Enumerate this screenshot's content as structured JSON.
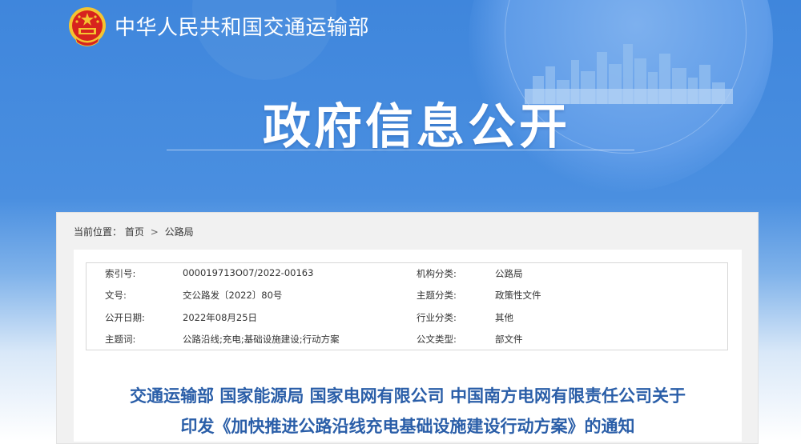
{
  "header": {
    "site_name": "中华人民共和国交通运输部",
    "banner_title": "政府信息公开"
  },
  "breadcrumb": {
    "prefix": "当前位置：",
    "items": [
      "首页",
      "公路局"
    ],
    "separator": ">"
  },
  "meta": {
    "rows": [
      [
        {
          "label": "索引号:",
          "value": "000019713O07/2022-00163"
        },
        {
          "label": "机构分类:",
          "value": "公路局"
        }
      ],
      [
        {
          "label": "文号:",
          "value": "交公路发〔2022〕80号"
        },
        {
          "label": "主题分类:",
          "value": "政策性文件"
        }
      ],
      [
        {
          "label": "公开日期:",
          "value": "2022年08月25日"
        },
        {
          "label": "行业分类:",
          "value": "其他"
        }
      ],
      [
        {
          "label": "主题词:",
          "value": "公路沿线;充电;基础设施建设;行动方案"
        },
        {
          "label": "公文类型:",
          "value": "部文件"
        }
      ]
    ]
  },
  "document": {
    "title_line1": "交通运输部 国家能源局 国家电网有限公司 中国南方电网有限责任公司关于",
    "title_line2": "印发《加快推进公路沿线充电基础设施建设行动方案》的通知"
  },
  "colors": {
    "hero_blue": "#3f86dc",
    "title_blue": "#2a5ea8",
    "emblem_red": "#d7231e",
    "emblem_gold": "#f4c430"
  },
  "icons": {
    "logo": "national-emblem-icon"
  }
}
